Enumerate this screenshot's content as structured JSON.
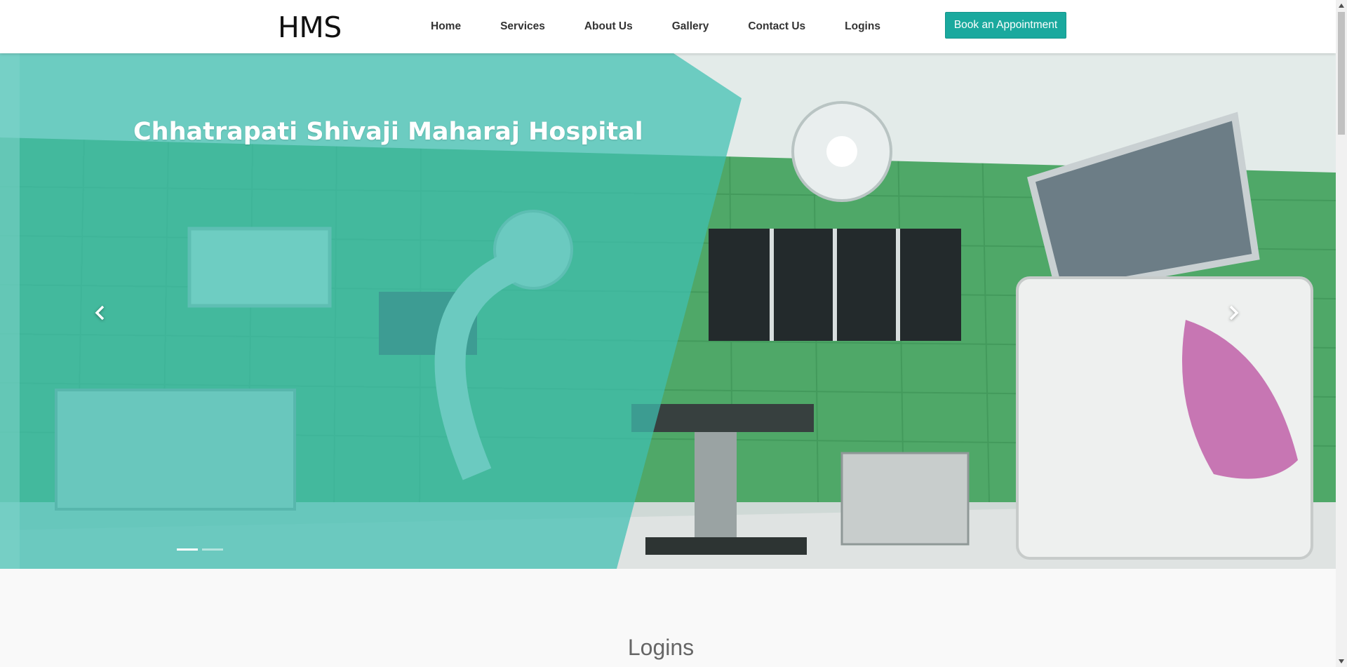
{
  "brand": {
    "logo_text": "HMS"
  },
  "nav": {
    "items": [
      {
        "label": "Home"
      },
      {
        "label": "Services"
      },
      {
        "label": "About Us"
      },
      {
        "label": "Gallery"
      },
      {
        "label": "Contact Us"
      },
      {
        "label": "Logins"
      }
    ],
    "cta_label": "Book an Appointment"
  },
  "hero": {
    "title": "Chhatrapati Shivaji Maharaj Hospital",
    "prev_icon": "chevron-left-icon",
    "next_icon": "chevron-right-icon",
    "slide_count": 2,
    "active_slide": 1
  },
  "section": {
    "heading": "Logins"
  },
  "colors": {
    "accent": "#1aa99e",
    "overlay": "#3fbfb2",
    "nav_text": "#333333",
    "heading_text": "#666666"
  }
}
